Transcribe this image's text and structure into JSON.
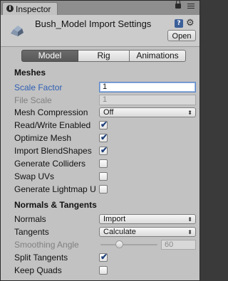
{
  "window": {
    "tab_label": "Inspector",
    "tab_icon": "info-icon"
  },
  "header": {
    "title": "Bush_Model Import Settings",
    "icon": "model-icon",
    "open_label": "Open"
  },
  "tabs": [
    {
      "label": "Model",
      "selected": true
    },
    {
      "label": "Rig",
      "selected": false
    },
    {
      "label": "Animations",
      "selected": false
    }
  ],
  "meshes": {
    "title": "Meshes",
    "scale_factor": {
      "label": "Scale Factor",
      "value": "1"
    },
    "file_scale": {
      "label": "File Scale",
      "value": "1"
    },
    "mesh_compression": {
      "label": "Mesh Compression",
      "value": "Off"
    },
    "read_write": {
      "label": "Read/Write Enabled",
      "checked": true
    },
    "optimize_mesh": {
      "label": "Optimize Mesh",
      "checked": true
    },
    "import_blendshapes": {
      "label": "Import BlendShapes",
      "checked": true
    },
    "generate_colliders": {
      "label": "Generate Colliders",
      "checked": false
    },
    "swap_uvs": {
      "label": "Swap UVs",
      "checked": false
    },
    "generate_lightmap_uvs": {
      "label": "Generate Lightmap U",
      "checked": false
    }
  },
  "normals_tangents": {
    "title": "Normals & Tangents",
    "normals": {
      "label": "Normals",
      "value": "Import"
    },
    "tangents": {
      "label": "Tangents",
      "value": "Calculate"
    },
    "smoothing_angle": {
      "label": "Smoothing Angle",
      "value": "60",
      "fraction": 0.33
    },
    "split_tangents": {
      "label": "Split Tangents",
      "checked": true
    },
    "keep_quads": {
      "label": "Keep Quads",
      "checked": false
    }
  },
  "check_glyph": "✔",
  "dropdown_arrow": "⬍"
}
